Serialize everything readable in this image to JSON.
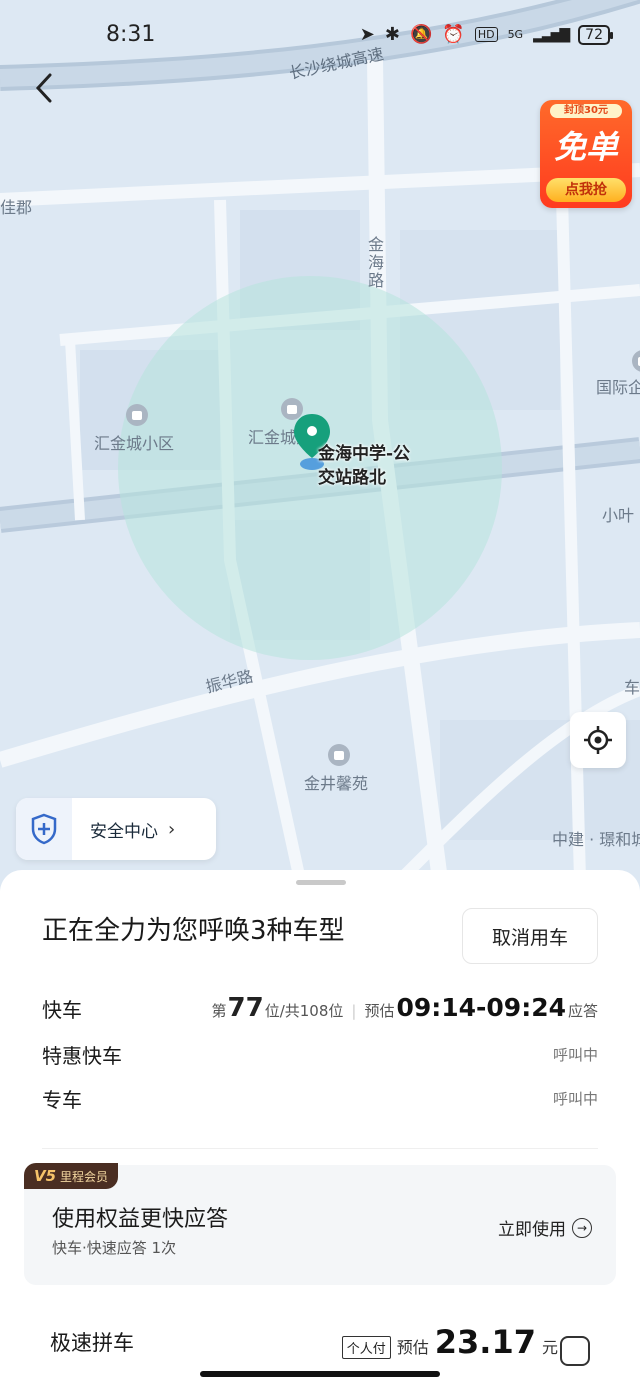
{
  "status_bar": {
    "time": "8:31",
    "network": "5G",
    "battery": "72"
  },
  "promo": {
    "top_text": "封顶30元",
    "main_text": "免单",
    "button_text": "点我抢"
  },
  "map": {
    "road_labels": {
      "highway": "长沙绕城高速",
      "jinhai_road": "金海路",
      "zhenhua_road": "振华路",
      "left_edge": "佳郡"
    },
    "poi": {
      "huijin_xiaoqu": "汇金城小区",
      "huijin_cheng": "汇金城湖",
      "guoji": "国际企",
      "xiaoye": "小叶",
      "jinjing": "金井馨苑",
      "zhongjian": "中建 · 璟和城",
      "che": "车"
    },
    "pickup_label_line1": "金海中学-公",
    "pickup_label_line2": "交站路北"
  },
  "safety": {
    "label": "安全中心"
  },
  "sheet": {
    "title": "正在全力为您呼唤3种车型",
    "cancel_label": "取消用车",
    "rows": [
      {
        "name": "快车",
        "queue_prefix": "第",
        "queue_num": "77",
        "queue_suffix": "位/共108位",
        "eta_prefix": "预估",
        "eta": "09:14-09:24",
        "eta_suffix": "应答"
      },
      {
        "name": "特惠快车",
        "status": "呼叫中"
      },
      {
        "name": "专车",
        "status": "呼叫中"
      }
    ],
    "member": {
      "level": "V5",
      "badge": "里程会员",
      "title": "使用权益更快应答",
      "subtitle": "快车·快速应答 1次",
      "action": "立即使用",
      "action_icon": "arrow-right-circle-icon"
    },
    "pool": {
      "name": "极速拼车",
      "pay_tag": "个人付",
      "est_label": "预估",
      "price": "23.17",
      "unit": "元"
    }
  }
}
